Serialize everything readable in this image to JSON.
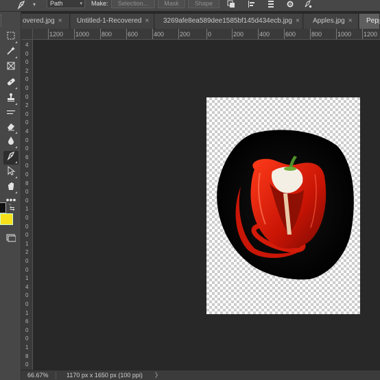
{
  "options_bar": {
    "tool_icon": "pen-tool-icon",
    "mode_value": "Path",
    "make_label": "Make:",
    "selection_button": "Selection...",
    "mask_button": "Mask",
    "shape_button": "Shape"
  },
  "tabs": [
    {
      "label": "overed.jpg"
    },
    {
      "label": "Untitled-1-Recovered"
    },
    {
      "label": "3269afe8ea589dee1585bf145d434ecb.jpg"
    },
    {
      "label": "Apples.jpg"
    },
    {
      "label": "Peppe",
      "active": true
    }
  ],
  "tab_close_glyph": "×",
  "ruler": {
    "horizontal_labels": [
      "1200",
      "1000",
      "800",
      "600",
      "400",
      "200",
      "0",
      "200",
      "400",
      "600",
      "800",
      "1000",
      "1200"
    ],
    "vertical_labels": [
      "4",
      "0",
      "0",
      "2",
      "0",
      "0",
      "0",
      "2",
      "0",
      "0",
      "4",
      "0",
      "0",
      "6",
      "0",
      "0",
      "8",
      "0",
      "0",
      "1",
      "0",
      "0",
      "0",
      "1",
      "2",
      "0",
      "0",
      "1",
      "4",
      "0",
      "0",
      "1",
      "6",
      "0",
      "0",
      "1",
      "8",
      "0",
      "0"
    ]
  },
  "toolbar": {
    "tools": [
      "marquee-icon",
      "magic-wand-icon",
      "frame-icon",
      "healing-brush-icon",
      "clone-stamp-icon",
      "eraser-icon",
      "blur-drop-icon",
      "pen-tool-icon",
      "path-selection-icon",
      "hand-icon",
      "more-tools-icon"
    ],
    "foreground_color": "#111111",
    "background_color": "#f7e11a"
  },
  "document": {
    "subject": "red-pepper-image"
  },
  "status": {
    "zoom": "66.67%",
    "info": "1170 px x 1650 px (100 ppi)",
    "arrow": "〉"
  }
}
